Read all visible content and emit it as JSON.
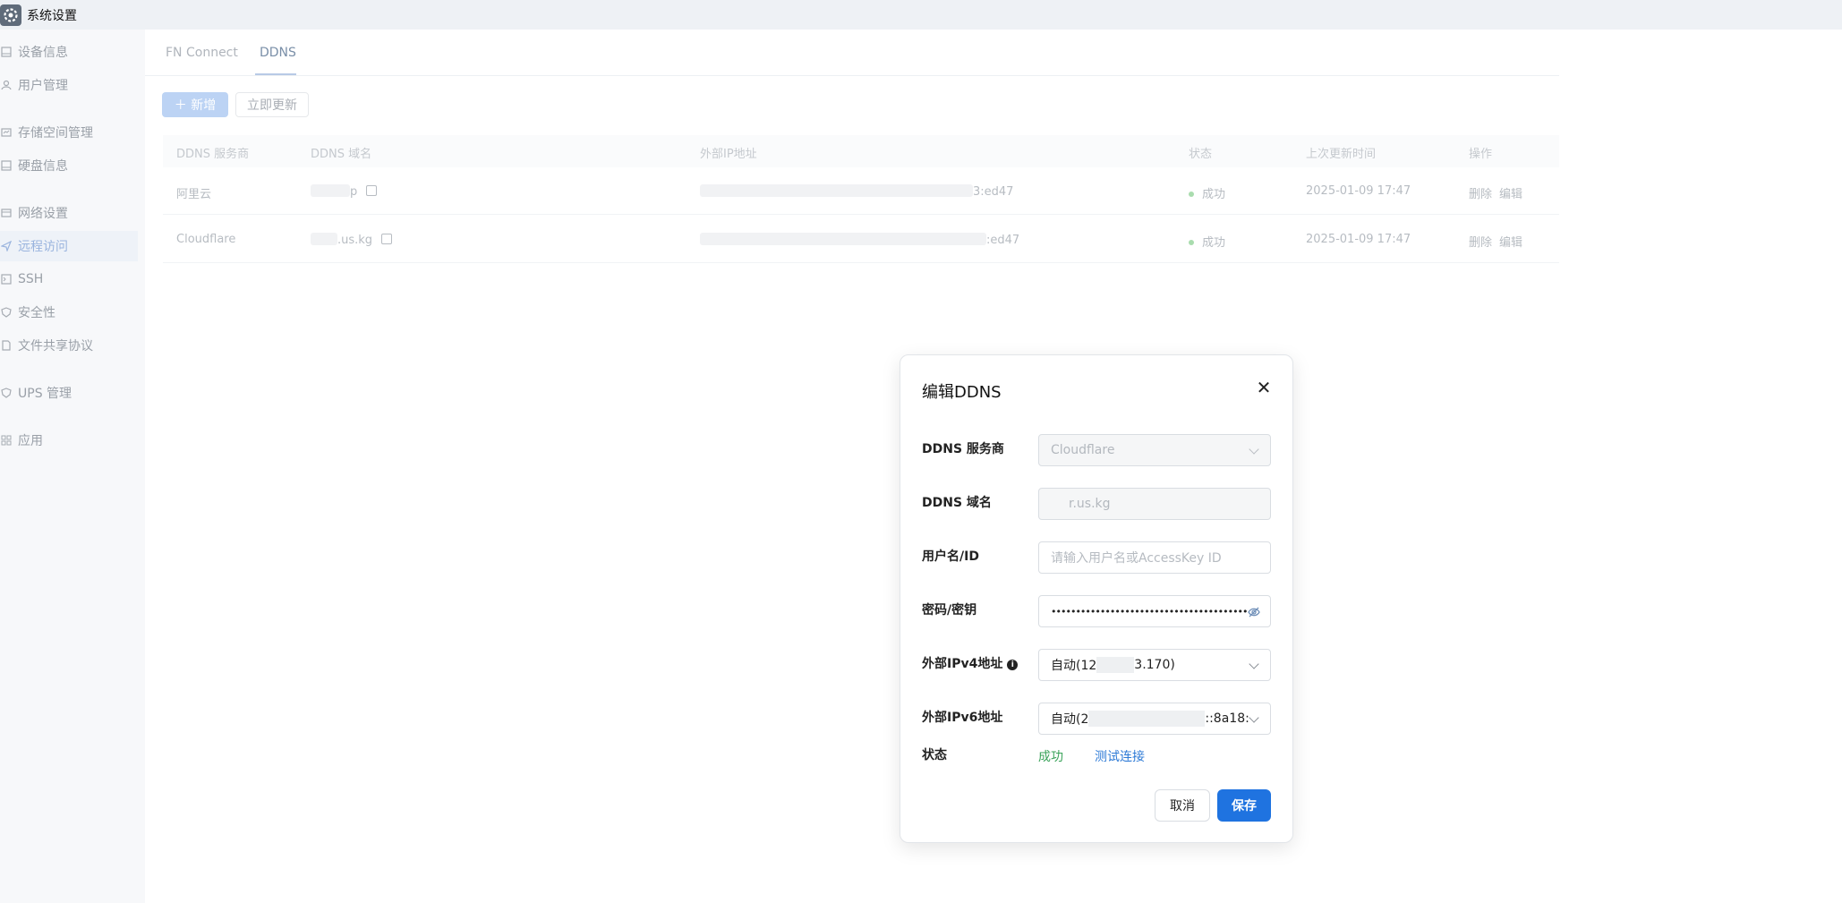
{
  "window": {
    "title": "系统设置",
    "icon": "gear-icon"
  },
  "sidebar": {
    "items": [
      {
        "label": "设备信息",
        "icon": "device-icon"
      },
      {
        "label": "用户管理",
        "icon": "user-icon"
      },
      {
        "label": "存储空间管理",
        "icon": "storage-icon"
      },
      {
        "label": "硬盘信息",
        "icon": "disk-icon"
      },
      {
        "label": "网络设置",
        "icon": "network-icon"
      },
      {
        "label": "远程访问",
        "icon": "send-icon",
        "active": true
      },
      {
        "label": "SSH",
        "icon": "terminal-icon"
      },
      {
        "label": "安全性",
        "icon": "shield-icon"
      },
      {
        "label": "文件共享协议",
        "icon": "file-share-icon"
      },
      {
        "label": "UPS 管理",
        "icon": "ups-icon"
      },
      {
        "label": "应用",
        "icon": "apps-icon"
      }
    ]
  },
  "tabs": [
    {
      "label": "FN Connect"
    },
    {
      "label": "DDNS",
      "active": true
    }
  ],
  "toolbar": {
    "new_label": "＋ 新增",
    "refresh_label": "立即更新"
  },
  "table": {
    "headers": [
      "DDNS 服务商",
      "DDNS 域名",
      "外部IP地址",
      "状态",
      "上次更新时间",
      "操作"
    ],
    "rows": [
      {
        "provider": "阿里云",
        "domain": "p",
        "ip": "3:ed47",
        "status": "成功",
        "updated": "2025-01-09 17:47",
        "delete": "删除",
        "edit": "编辑"
      },
      {
        "provider": "Cloudflare",
        "domain": ".us.kg",
        "ip": ":ed47",
        "status": "成功",
        "updated": "2025-01-09 17:47",
        "delete": "删除",
        "edit": "编辑"
      }
    ]
  },
  "dialog": {
    "title": "编辑DDNS",
    "close_icon": "close-icon",
    "provider": {
      "label": "DDNS 服务商",
      "value": "Cloudflare"
    },
    "domain": {
      "label": "DDNS 域名",
      "value": "r.us.kg"
    },
    "username": {
      "label": "用户名/ID",
      "placeholder": "请输入用户名或AccessKey ID"
    },
    "password": {
      "label": "密码/密钥",
      "value": "••••••••••••••••••••••••••••••••••••••••"
    },
    "ipv4": {
      "label": "外部IPv4地址",
      "value_prefix": "自动(12",
      "value_suffix": "3.170)"
    },
    "ipv6": {
      "label": "外部IPv6地址",
      "value_prefix": "自动(2",
      "value_suffix": "::8a18:"
    },
    "status": {
      "label": "状态",
      "value": "成功",
      "test_link": "测试连接"
    },
    "cancel_label": "取消",
    "save_label": "保存"
  },
  "colors": {
    "accent": "#1f73e0",
    "success": "#3aa35a",
    "link": "#2d7ad6"
  }
}
